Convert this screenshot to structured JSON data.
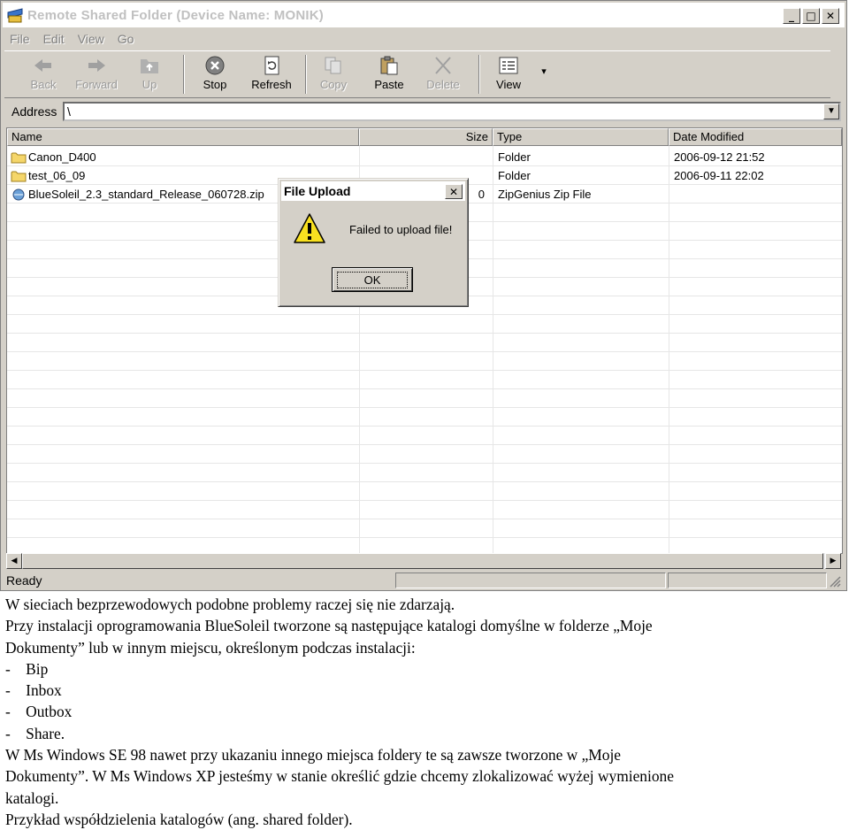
{
  "window": {
    "title": "Remote Shared Folder (Device Name: MONIK)",
    "controls": {
      "minimize": "_",
      "maximize": "□",
      "close": "✕"
    }
  },
  "menu": [
    "File",
    "Edit",
    "View",
    "Go"
  ],
  "toolbar": {
    "back": "Back",
    "forward": "Forward",
    "up": "Up",
    "stop": "Stop",
    "refresh": "Refresh",
    "copy": "Copy",
    "paste": "Paste",
    "delete": "Delete",
    "view": "View",
    "view_dropdown": "▾"
  },
  "address": {
    "label": "Address",
    "value": "\\",
    "dropdown": "▼"
  },
  "columns": {
    "name": "Name",
    "size": "Size",
    "type": "Type",
    "date": "Date Modified"
  },
  "files": [
    {
      "name": "Canon_D400",
      "size": "",
      "type": "Folder",
      "date": "2006-09-12 21:52",
      "icon": "folder-icon"
    },
    {
      "name": "test_06_09",
      "size": "",
      "type": "Folder",
      "date": "2006-09-11 22:02",
      "icon": "folder-icon"
    },
    {
      "name": "BlueSoleil_2.3_standard_Release_060728.zip",
      "size": "0",
      "type": "ZipGenius Zip File",
      "date": "",
      "icon": "zip-file-icon"
    }
  ],
  "scroll": {
    "left": "◀",
    "right": "▶"
  },
  "status": {
    "text": "Ready"
  },
  "dialog": {
    "title": "File Upload",
    "close": "✕",
    "message": "Failed to upload file!",
    "ok": "OK",
    "icon": "warning-icon"
  },
  "document": {
    "lines": [
      "W sieciach bezprzewodowych podobne problemy raczej się nie zdarzają.",
      "Przy instalacji oprogramowania BlueSoleil tworzone są następujące katalogi domyślne w folderze „Moje",
      "Dokumenty” lub w innym miejscu, określonym podczas instalacji:",
      "-    Bip",
      "-    Inbox",
      "-    Outbox",
      "-    Share.",
      "W Ms Windows SE 98 nawet przy ukazaniu innego miejsca foldery te są zawsze tworzone w „Moje",
      "Dokumenty”. W Ms Windows XP jesteśmy w stanie określić gdzie chcemy zlokalizować wyżej wymienione",
      "katalogi.",
      "Przykład współdzielenia katalogów (ang. shared folder)."
    ]
  }
}
